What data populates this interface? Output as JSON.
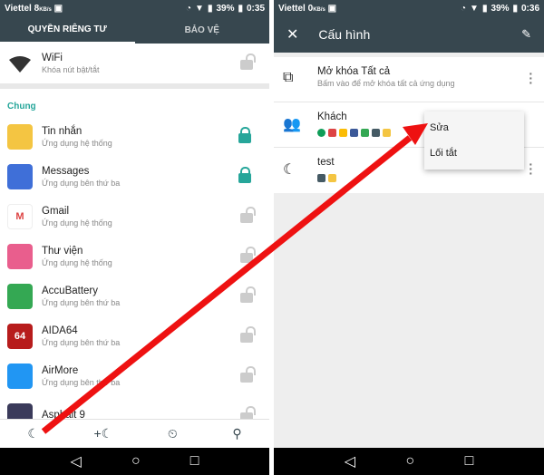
{
  "left": {
    "status": {
      "carrier": "Viettel",
      "speed": "8",
      "speed_unit": "KB/s",
      "battery": "39%",
      "time": "0:35"
    },
    "tabs": [
      {
        "label": "QUYỀN RIÊNG TƯ",
        "active": true
      },
      {
        "label": "BẢO VỆ",
        "active": false
      }
    ],
    "wifi": {
      "title": "WiFi",
      "subtitle": "Khóa nút bật/tắt",
      "locked": false
    },
    "section": "Chung",
    "apps": [
      {
        "name": "Tin nhắn",
        "type": "Ứng dụng hệ thống",
        "locked": true,
        "color": "#f4c542"
      },
      {
        "name": "Messages",
        "type": "Ứng dụng bên thứ ba",
        "locked": true,
        "color": "#3f6fd8"
      },
      {
        "name": "Gmail",
        "type": "Ứng dụng hệ thống",
        "locked": false,
        "color": "#ffffff"
      },
      {
        "name": "Thư viện",
        "type": "Ứng dụng hệ thống",
        "locked": false,
        "color": "#e95e8d"
      },
      {
        "name": "AccuBattery",
        "type": "Ứng dụng bên thứ ba",
        "locked": false,
        "color": "#34a853"
      },
      {
        "name": "AIDA64",
        "type": "Ứng dụng bên thứ ba",
        "locked": false,
        "color": "#b71c1c"
      },
      {
        "name": "AirMore",
        "type": "Ứng dụng bên thứ ba",
        "locked": false,
        "color": "#2196f3"
      },
      {
        "name": "Asphalt 9",
        "type": "",
        "locked": false,
        "color": "#3a3a5a"
      }
    ],
    "icon_labels": {
      "aida": "64"
    }
  },
  "right": {
    "status": {
      "carrier": "Viettel",
      "speed": "0",
      "speed_unit": "KB/s",
      "battery": "39%",
      "time": "0:36"
    },
    "title": "Cấu hình",
    "profiles": [
      {
        "name": "Mở khóa Tất cả",
        "subtitle": "Bấm vào để mở khóa tất cả ứng dụng"
      },
      {
        "name": "Khách"
      },
      {
        "name": "test"
      }
    ],
    "menu": [
      "Sửa",
      "Lối tắt"
    ],
    "fab": "+"
  },
  "accent": "#26a69a",
  "header_color": "#37474f",
  "arrow_color": "#ee1111"
}
